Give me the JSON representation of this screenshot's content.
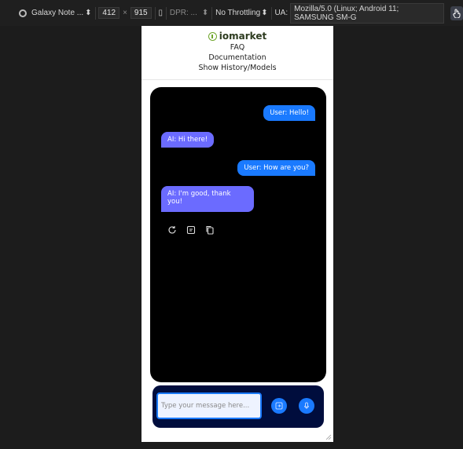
{
  "devtools": {
    "device_name": "Galaxy Note ...",
    "width": "412",
    "times": "×",
    "height": "915",
    "dpr_label": "DPR: ...",
    "throttling": "No Throttling",
    "ua_label": "UA:",
    "ua_value": "Mozilla/5.0 (Linux; Android 11; SAMSUNG SM-G"
  },
  "header": {
    "brand": "iomarket",
    "links": [
      "FAQ",
      "Documentation",
      "Show History/Models"
    ]
  },
  "messages": [
    {
      "role": "user",
      "text": "User: Hello!"
    },
    {
      "role": "ai",
      "text": "AI: Hi there!"
    },
    {
      "role": "user",
      "text": "User: How are you?"
    },
    {
      "role": "ai",
      "text": "AI: I'm good, thank you!"
    }
  ],
  "message_actions": [
    "refresh-icon",
    "feedback-icon",
    "copy-icon"
  ],
  "composer": {
    "placeholder": "Type your message here...",
    "send_icon": "send-icon",
    "mic_icon": "mic-icon"
  },
  "colors": {
    "user_bubble": "#1a7aff",
    "ai_bubble": "#6b6bff",
    "chat_bg": "#000000",
    "composer_bg": "#000d3d",
    "brand_green": "#6ea52a"
  }
}
